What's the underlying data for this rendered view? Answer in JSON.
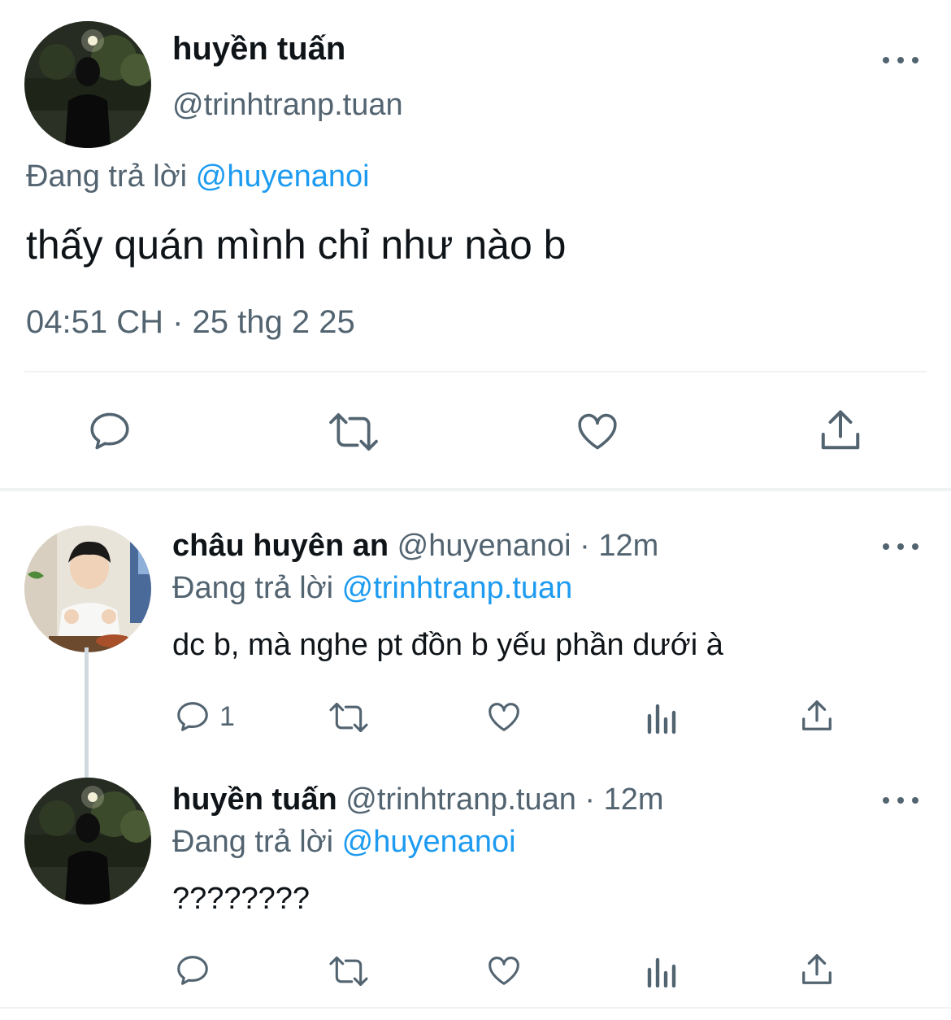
{
  "colors": {
    "text": "#0f1419",
    "secondary": "#536471",
    "accent": "#1d9bf0",
    "divider": "#eff3f4",
    "thread_line": "#cfd9de"
  },
  "main_tweet": {
    "author_name": "huyền tuấn",
    "handle": "@trinhtranp.tuan",
    "replying_prefix": "Đang trả lời",
    "replying_to": "@huyenanoi",
    "text": "thấy quán mình chỉ như nào b",
    "timestamp": "04:51 CH · 25 thg 2 25",
    "actions": [
      "reply-icon",
      "retweet-icon",
      "like-icon",
      "share-icon"
    ]
  },
  "replies": [
    {
      "author_name": "châu huyên an",
      "meta": "@huyenanoi · 12m",
      "replying_prefix": "Đang trả lời",
      "replying_to": "@trinhtranp.tuan",
      "text": "dc b, mà nghe pt đồn b yếu phần dưới à",
      "reply_count": "1",
      "actions": [
        "reply-icon",
        "retweet-icon",
        "like-icon",
        "analytics-icon",
        "share-icon"
      ]
    },
    {
      "author_name": "huyền tuấn",
      "meta": "@trinhtranp.tuan · 12m",
      "replying_prefix": "Đang trả lời",
      "replying_to": "@huyenanoi",
      "text": "????????",
      "reply_count": "",
      "actions": [
        "reply-icon",
        "retweet-icon",
        "like-icon",
        "analytics-icon",
        "share-icon"
      ]
    }
  ]
}
